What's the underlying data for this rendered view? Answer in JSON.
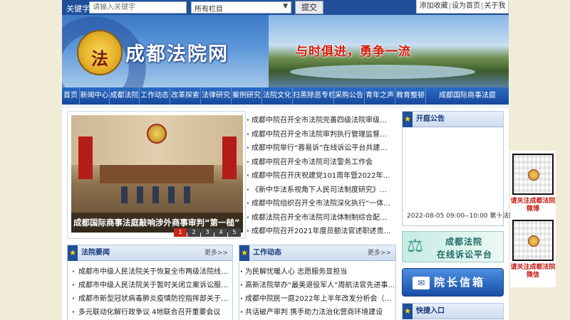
{
  "search": {
    "keyword_label": "关键字：",
    "keyword_placeholder": "请输入关键字",
    "column_label": "栏目：",
    "column_selected": "所有栏目",
    "submit_label": "提交"
  },
  "top_links": [
    "添加收藏",
    "设为首页",
    "关于我们"
  ],
  "header": {
    "site_title": "成都法院网",
    "slogan": "与时俱进，勇争一流",
    "emblem_text": "法"
  },
  "nav": [
    "首页",
    "新闻中心",
    "成都法院",
    "工作动态",
    "改革探索",
    "法律研究",
    "案例研究",
    "法院文化",
    "扫黑除恶专栏",
    "采购公告",
    "青年之声",
    "教育整顿",
    "成都国际商事法庭"
  ],
  "slideshow": {
    "caption": "成都国际商事法庭敲响涉外商事审判“第一槌”",
    "pages": [
      "1",
      "2",
      "3",
      "4",
      "5"
    ],
    "active_page": "1"
  },
  "top_news": [
    "成都中院召开全市法院完善四级法院审级职能定位改革试点工作推进会",
    "成都中院召开全市法院审判执行管理监督委员会会议",
    "成都中院举行“蓉易诉”在线诉讼平台共建共享启动仪式",
    "成都中院召开全市法院司法警务工作会",
    "成都中院召开庆祝建党101周年暨2022年度表彰大会",
    "《新中华法系视角下人民司法制度研究》课题开题",
    "成都中院组织召开全市法院深化执行“一体化”推进会",
    "成都法院召开全市法院司法体制制综合配套改革推进会",
    "成都中院召开2021年度员额法官述职述责述廉会"
  ],
  "notice": {
    "title": "开庭公告",
    "entry": "2022-08-05 09:00--10:00 第十法庭"
  },
  "online_platform": {
    "line1": "成都法院",
    "line2": "在线诉讼平台"
  },
  "president_mailbox": "院长信箱",
  "quick_entry": "快捷入口",
  "court_news": {
    "title": "法院要闻",
    "more": "更多>>",
    "items": [
      "成都市中级人民法院关于恢复全市两级法院线下诉讼服务的公告",
      "成都市中级人民法院关于暂时关闭立案诉讼服务大厅的公告",
      "成都市新型冠状病毒肺炎疫情防控指挥部关于在全市开展全员核酸检测的通告",
      "多元联动化解行政争议 4地联合召开重要会议"
    ]
  },
  "work_news": {
    "title": "工作动态",
    "more": "更多>>",
    "items": [
      "为民解忧暖人心 志愿服务显担当",
      "高新法院举办“最美退役军人”周航法官先进事迹报告会",
      "成都中院民一庭2022年上半年改发分析会（南部片区）",
      "共话破产审判 携手助力法治化营商环境建设"
    ]
  },
  "float_qr": {
    "caption1": "请关注成都法院微博",
    "caption2": "请关注成都法院微信"
  }
}
